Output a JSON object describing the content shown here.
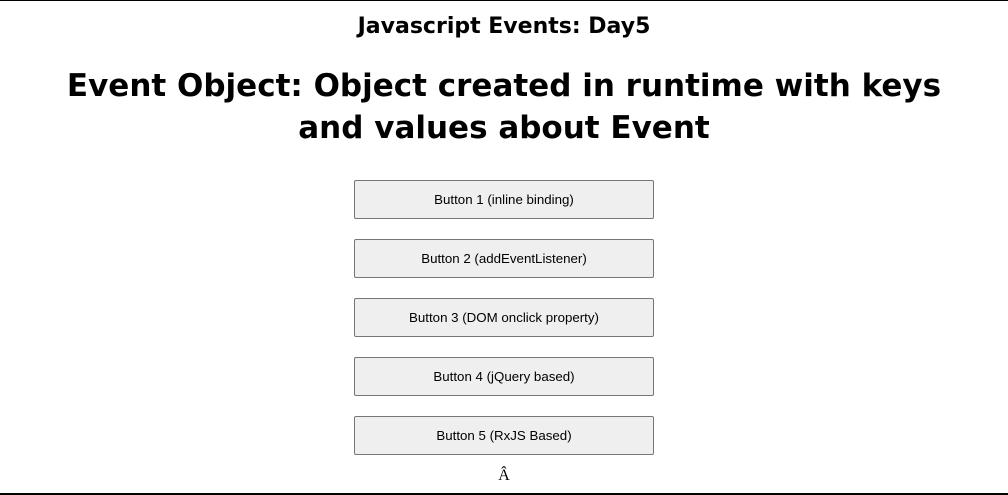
{
  "page": {
    "subtitle": "Javascript Events: Day5",
    "headline": "Event Object: Object created in runtime with keys and values about Event",
    "stray_text": "Â"
  },
  "buttons": [
    {
      "label": "Button 1 (inline binding)"
    },
    {
      "label": "Button 2 (addEventListener)"
    },
    {
      "label": "Button 3 (DOM onclick property)"
    },
    {
      "label": "Button 4 (jQuery based)"
    },
    {
      "label": "Button 5 (RxJS Based)"
    }
  ],
  "colors": {
    "background": "#ffffff",
    "button_background": "#efefef",
    "button_border": "#767676",
    "text": "#000000"
  }
}
